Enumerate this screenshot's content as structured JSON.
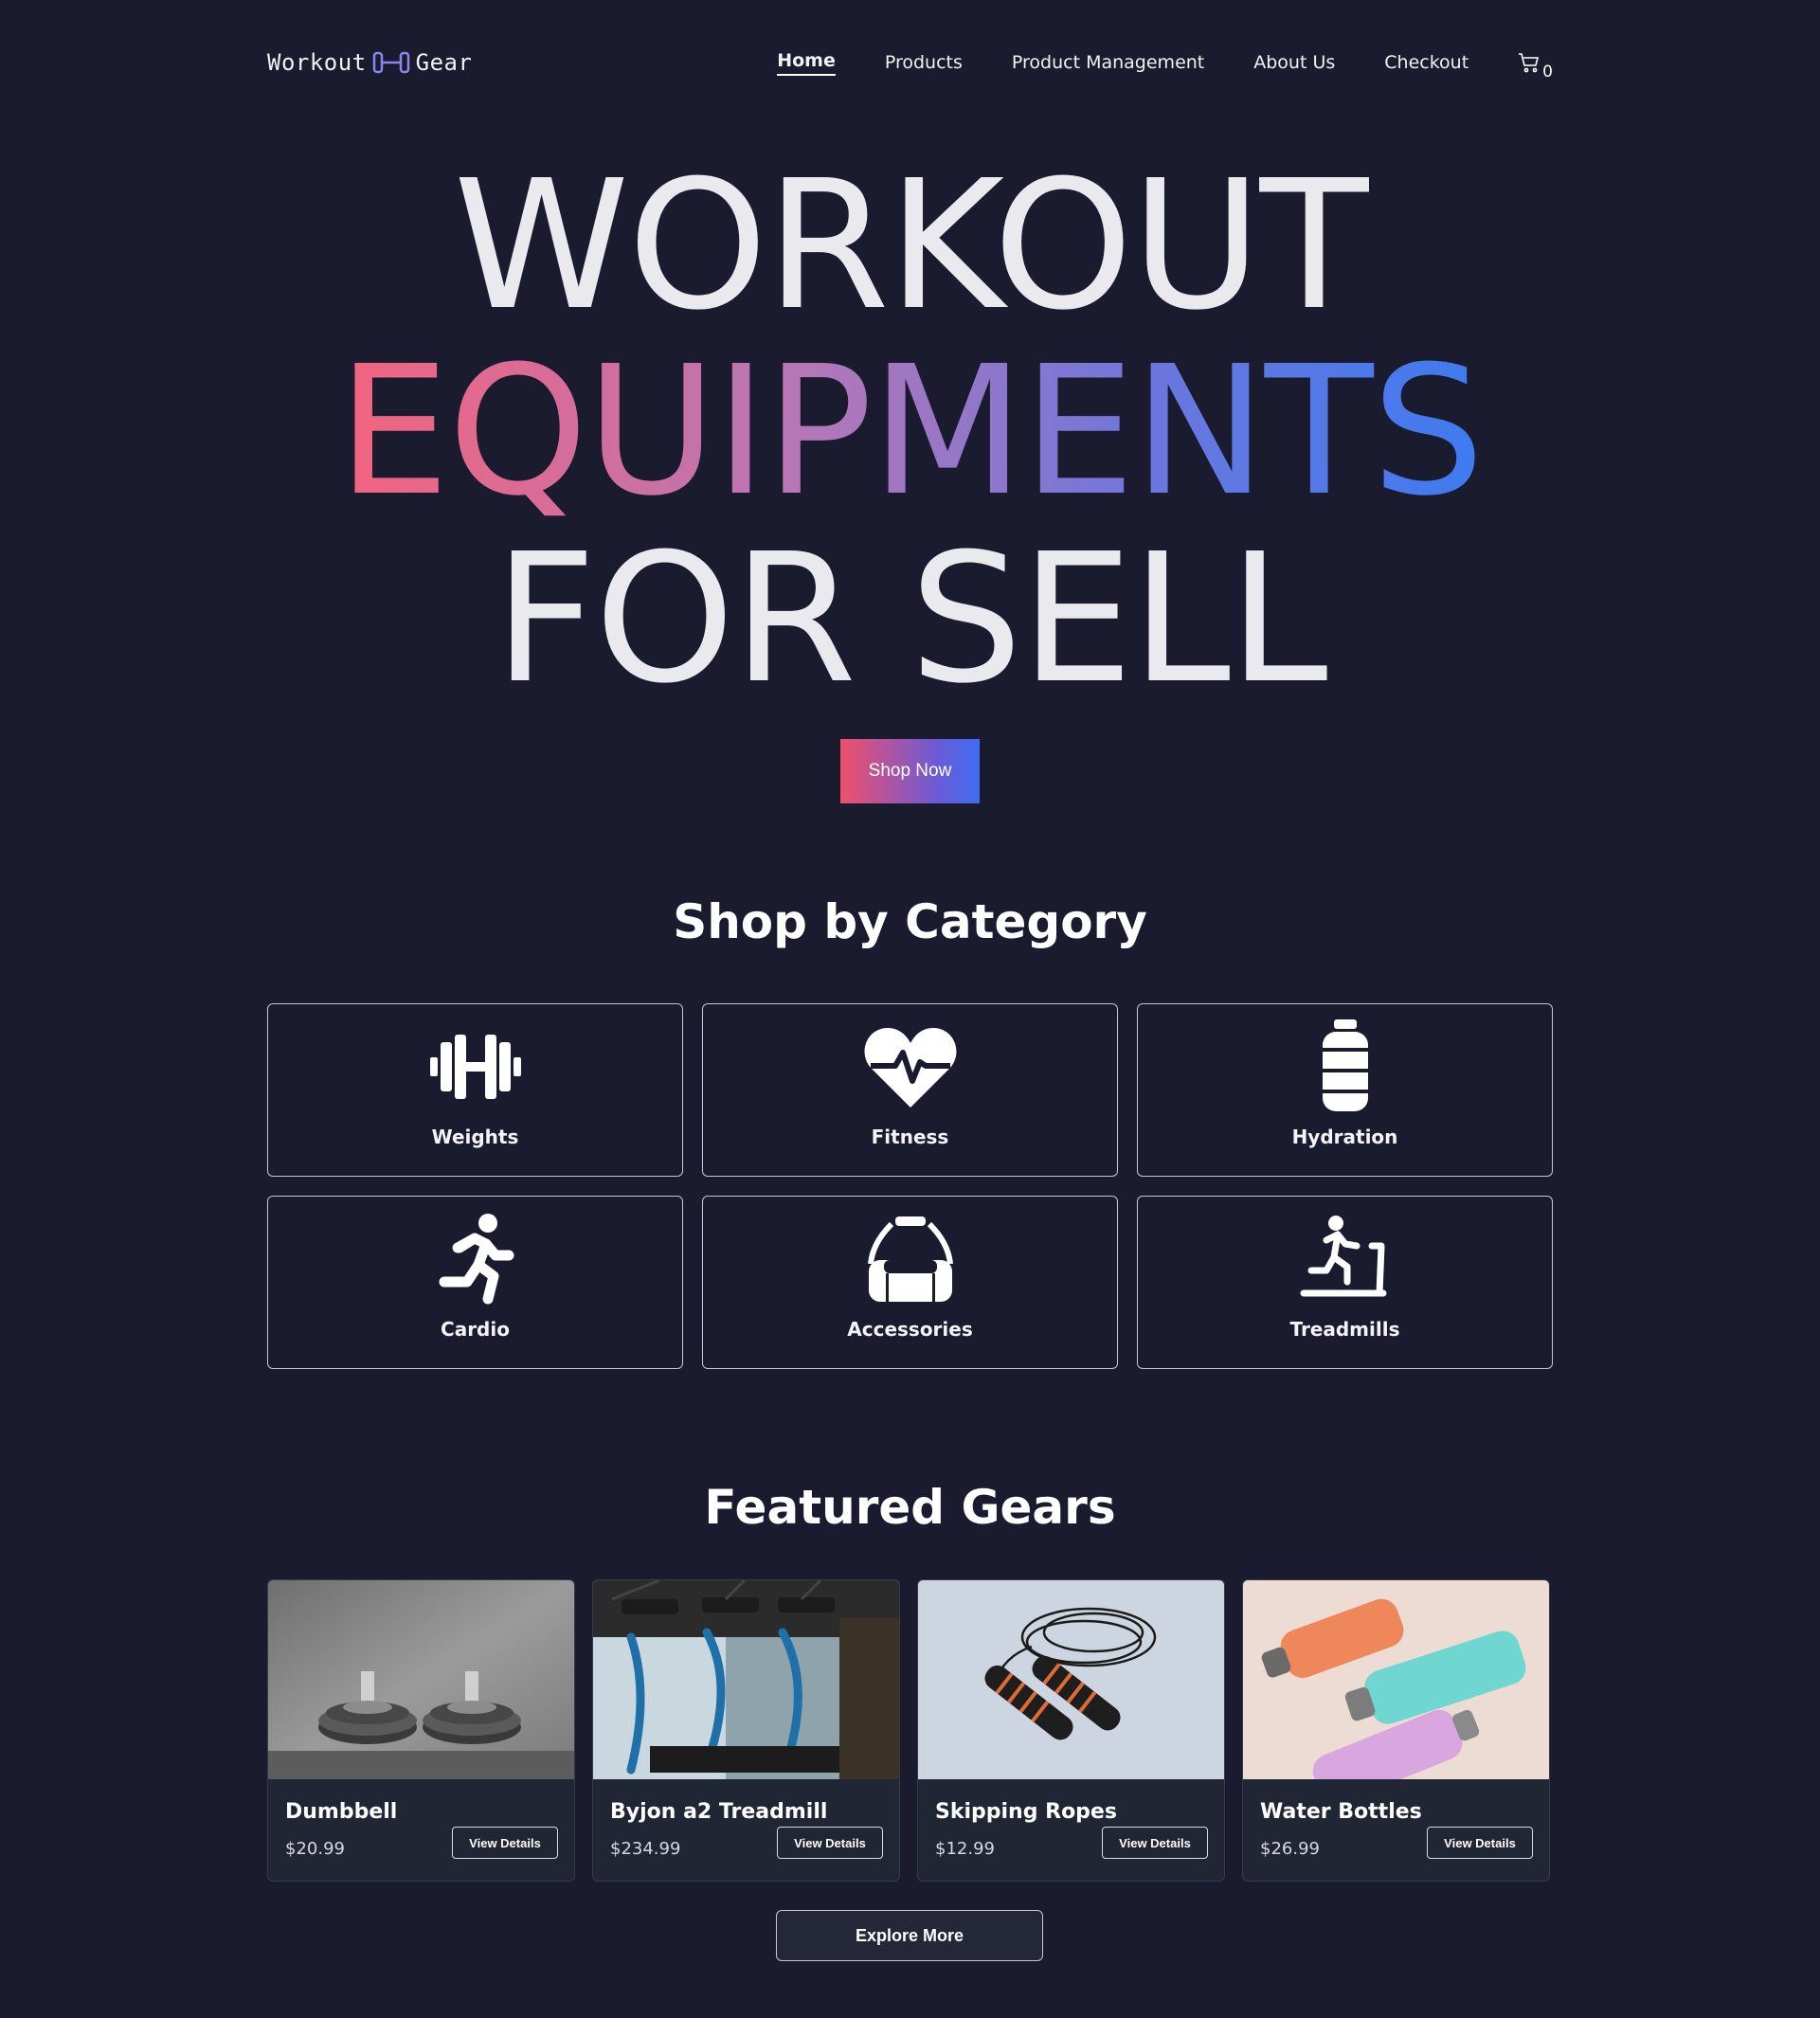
{
  "brand": {
    "left": "Workout",
    "right": "Gear",
    "icon": "dumbbell-icon",
    "icon_color": "#8a86f0"
  },
  "nav": {
    "items": [
      "Home",
      "Products",
      "Product Management",
      "About Us",
      "Checkout"
    ],
    "active": "Home",
    "cart_icon": "cart-icon",
    "cart_count": "0"
  },
  "hero": {
    "line1": "WORKOUT",
    "line2": "EQUIPMENTS",
    "line3": "FOR SELL",
    "cta": "Shop Now",
    "gradient": [
      "#f3647e",
      "#b777b6",
      "#6a77de",
      "#3d7bf0"
    ]
  },
  "categories": {
    "title": "Shop by Category",
    "items": [
      {
        "label": "Weights",
        "icon": "weights-icon"
      },
      {
        "label": "Fitness",
        "icon": "heartbeat-icon"
      },
      {
        "label": "Hydration",
        "icon": "bottle-icon"
      },
      {
        "label": "Cardio",
        "icon": "running-icon"
      },
      {
        "label": "Accessories",
        "icon": "gym-bag-icon"
      },
      {
        "label": "Treadmills",
        "icon": "treadmill-icon"
      }
    ]
  },
  "featured": {
    "title": "Featured Gears",
    "view_label": "View Details",
    "products": [
      {
        "name": "Dumbbell",
        "price": "$20.99"
      },
      {
        "name": "Byjon a2 Treadmill",
        "price": "$234.99"
      },
      {
        "name": "Skipping Ropes",
        "price": "$12.99"
      },
      {
        "name": "Water Bottles",
        "price": "$26.99"
      }
    ],
    "explore": "Explore More"
  },
  "colors": {
    "background": "#1a1b2e",
    "card": "#212634",
    "text": "#e8e8ee"
  }
}
